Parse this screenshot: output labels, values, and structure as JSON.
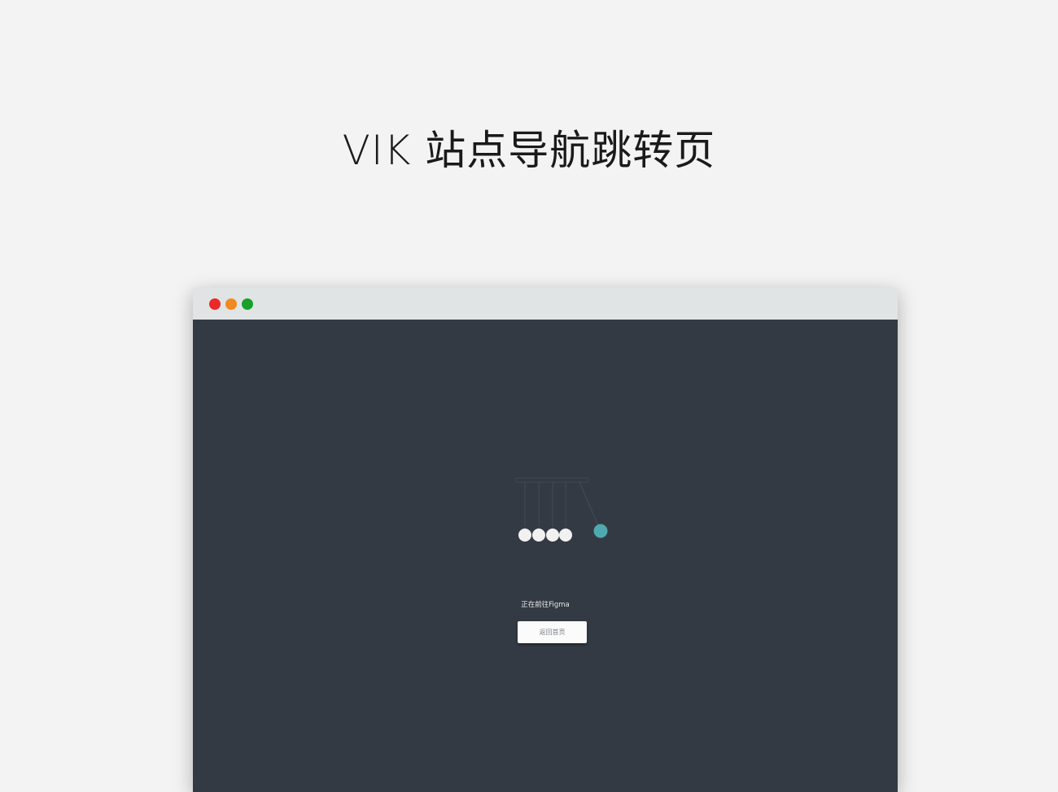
{
  "page": {
    "title": "VIK 站点导航跳转页"
  },
  "window": {
    "traffic_lights": {
      "close_color": "#ec2828",
      "minimize_color": "#f0891f",
      "maximize_color": "#18a12a"
    },
    "background_color": "#343a43",
    "titlebar_color": "#e1e4e4"
  },
  "redirect": {
    "message": "正在前往Figma",
    "home_button_label": "返回首页"
  },
  "loader": {
    "ball_color": "#f1f1f1",
    "active_ball_color": "#4fa9b0",
    "icon": "newtons-cradle-icon"
  }
}
